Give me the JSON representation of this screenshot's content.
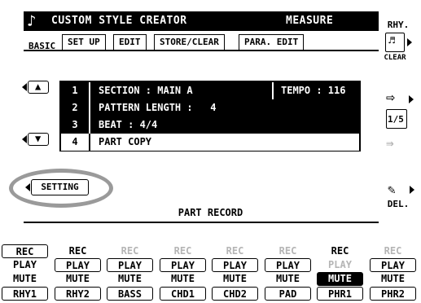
{
  "title_bar": {
    "icon": "music-note-icon",
    "title": "CUSTOM STYLE CREATOR",
    "measure_label": "MEASURE"
  },
  "tabs": [
    {
      "label": "BASIC",
      "active": true
    },
    {
      "label": "SET UP",
      "active": false
    },
    {
      "label": "EDIT",
      "active": false
    },
    {
      "label": "STORE/CLEAR",
      "active": false
    },
    {
      "label": "PARA. EDIT",
      "active": false
    }
  ],
  "right_panel": {
    "rhy_label": "RHY.",
    "clear_label": "CLEAR",
    "page_indicator": "1/5",
    "del_label": "DEL."
  },
  "params": [
    {
      "num": "1",
      "label": "SECTION : MAIN A",
      "extra": "TEMPO : 116"
    },
    {
      "num": "2",
      "label": "PATTERN LENGTH :   4"
    },
    {
      "num": "3",
      "label": "BEAT : 4/4"
    },
    {
      "num": "4",
      "label": "PART COPY"
    }
  ],
  "setting_label": "SETTING",
  "part_record_title": "PART RECORD",
  "channels": [
    {
      "name": "RHY1",
      "rec": "REC",
      "rec_state": "boxed",
      "play": "PLAY",
      "play_state": "normal",
      "mute": "MUTE",
      "mute_state": "normal"
    },
    {
      "name": "RHY2",
      "rec": "REC",
      "rec_state": "normal",
      "play": "PLAY",
      "play_state": "boxed",
      "mute": "MUTE",
      "mute_state": "normal"
    },
    {
      "name": "BASS",
      "rec": "REC",
      "rec_state": "dim",
      "play": "PLAY",
      "play_state": "boxed",
      "mute": "MUTE",
      "mute_state": "normal"
    },
    {
      "name": "CHD1",
      "rec": "REC",
      "rec_state": "dim",
      "play": "PLAY",
      "play_state": "boxed",
      "mute": "MUTE",
      "mute_state": "normal"
    },
    {
      "name": "CHD2",
      "rec": "REC",
      "rec_state": "dim",
      "play": "PLAY",
      "play_state": "boxed",
      "mute": "MUTE",
      "mute_state": "normal"
    },
    {
      "name": "PAD",
      "rec": "REC",
      "rec_state": "dim",
      "play": "PLAY",
      "play_state": "boxed",
      "mute": "MUTE",
      "mute_state": "normal"
    },
    {
      "name": "PHR1",
      "rec": "REC",
      "rec_state": "normal",
      "play": "PLAY",
      "play_state": "dim",
      "mute": "MUTE",
      "mute_state": "boxed"
    },
    {
      "name": "PHR2",
      "rec": "REC",
      "rec_state": "dim",
      "play": "PLAY",
      "play_state": "boxed",
      "mute": "MUTE",
      "mute_state": "normal"
    }
  ],
  "colors": {
    "foreground": "#000000",
    "background": "#ffffff",
    "dim": "#b5b5b5",
    "highlight_ring": "#9a9a9a"
  }
}
